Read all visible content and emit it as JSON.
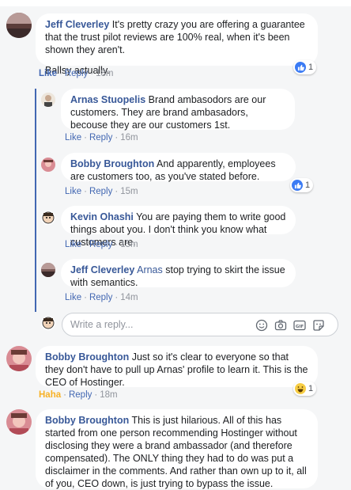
{
  "comments": [
    {
      "name": "Jeff Cleverley",
      "text": "It's pretty crazy you are offering a guarantee that the trust pilot reviews are 100% real, when it's been shown they aren't.",
      "text2": "Ballsy actually.",
      "like": "Like",
      "reply": "Reply",
      "time": "18m",
      "reaction_count": "1"
    },
    {
      "name": "Bobby Broughton",
      "text": "Just so it's clear to everyone so that they don't have to pull up Arnas' profile to learn it. This is the CEO of Hostinger.",
      "like": "Haha",
      "reply": "Reply",
      "time": "18m",
      "reaction_count": "1"
    },
    {
      "name": "Bobby Broughton",
      "text": "This is just hilarious. All of this has started from one person recommending Hostinger without disclosing they were a brand ambassador (and therefore compensated). The ONLY thing they had to do was put a disclaimer in the comments. And rather than own up to it, all of you, CEO down, is just trying to bypass the issue."
    }
  ],
  "replies": [
    {
      "name": "Arnas Stuopelis",
      "text": "Brand ambasodors are our customers. They are brand ambasadors, becouse they are our customers 1st.",
      "like": "Like",
      "reply": "Reply",
      "time": "16m"
    },
    {
      "name": "Bobby Broughton",
      "text": "And apparently, employees are customers too, as you've stated before.",
      "like": "Like",
      "reply": "Reply",
      "time": "15m",
      "reaction_count": "1"
    },
    {
      "name": "Kevin Ohashi",
      "text": "You are paying them to write good things about you. I don't think you know what customers are.",
      "like": "Like",
      "reply": "Reply",
      "time": "15m"
    },
    {
      "name": "Jeff Cleverley",
      "mention": "Arnas",
      "text": "stop trying to skirt the issue with semantics.",
      "like": "Like",
      "reply": "Reply",
      "time": "14m"
    }
  ],
  "reply_input": {
    "placeholder": "Write a reply..."
  },
  "icons": [
    "emoji-icon",
    "camera-icon",
    "gif-icon",
    "sticker-icon"
  ],
  "colors": {
    "link": "#385898",
    "accent": "#4267b2",
    "bubble": "#ffffff",
    "background": "#f5f6f7",
    "haha": "#f7b125"
  }
}
